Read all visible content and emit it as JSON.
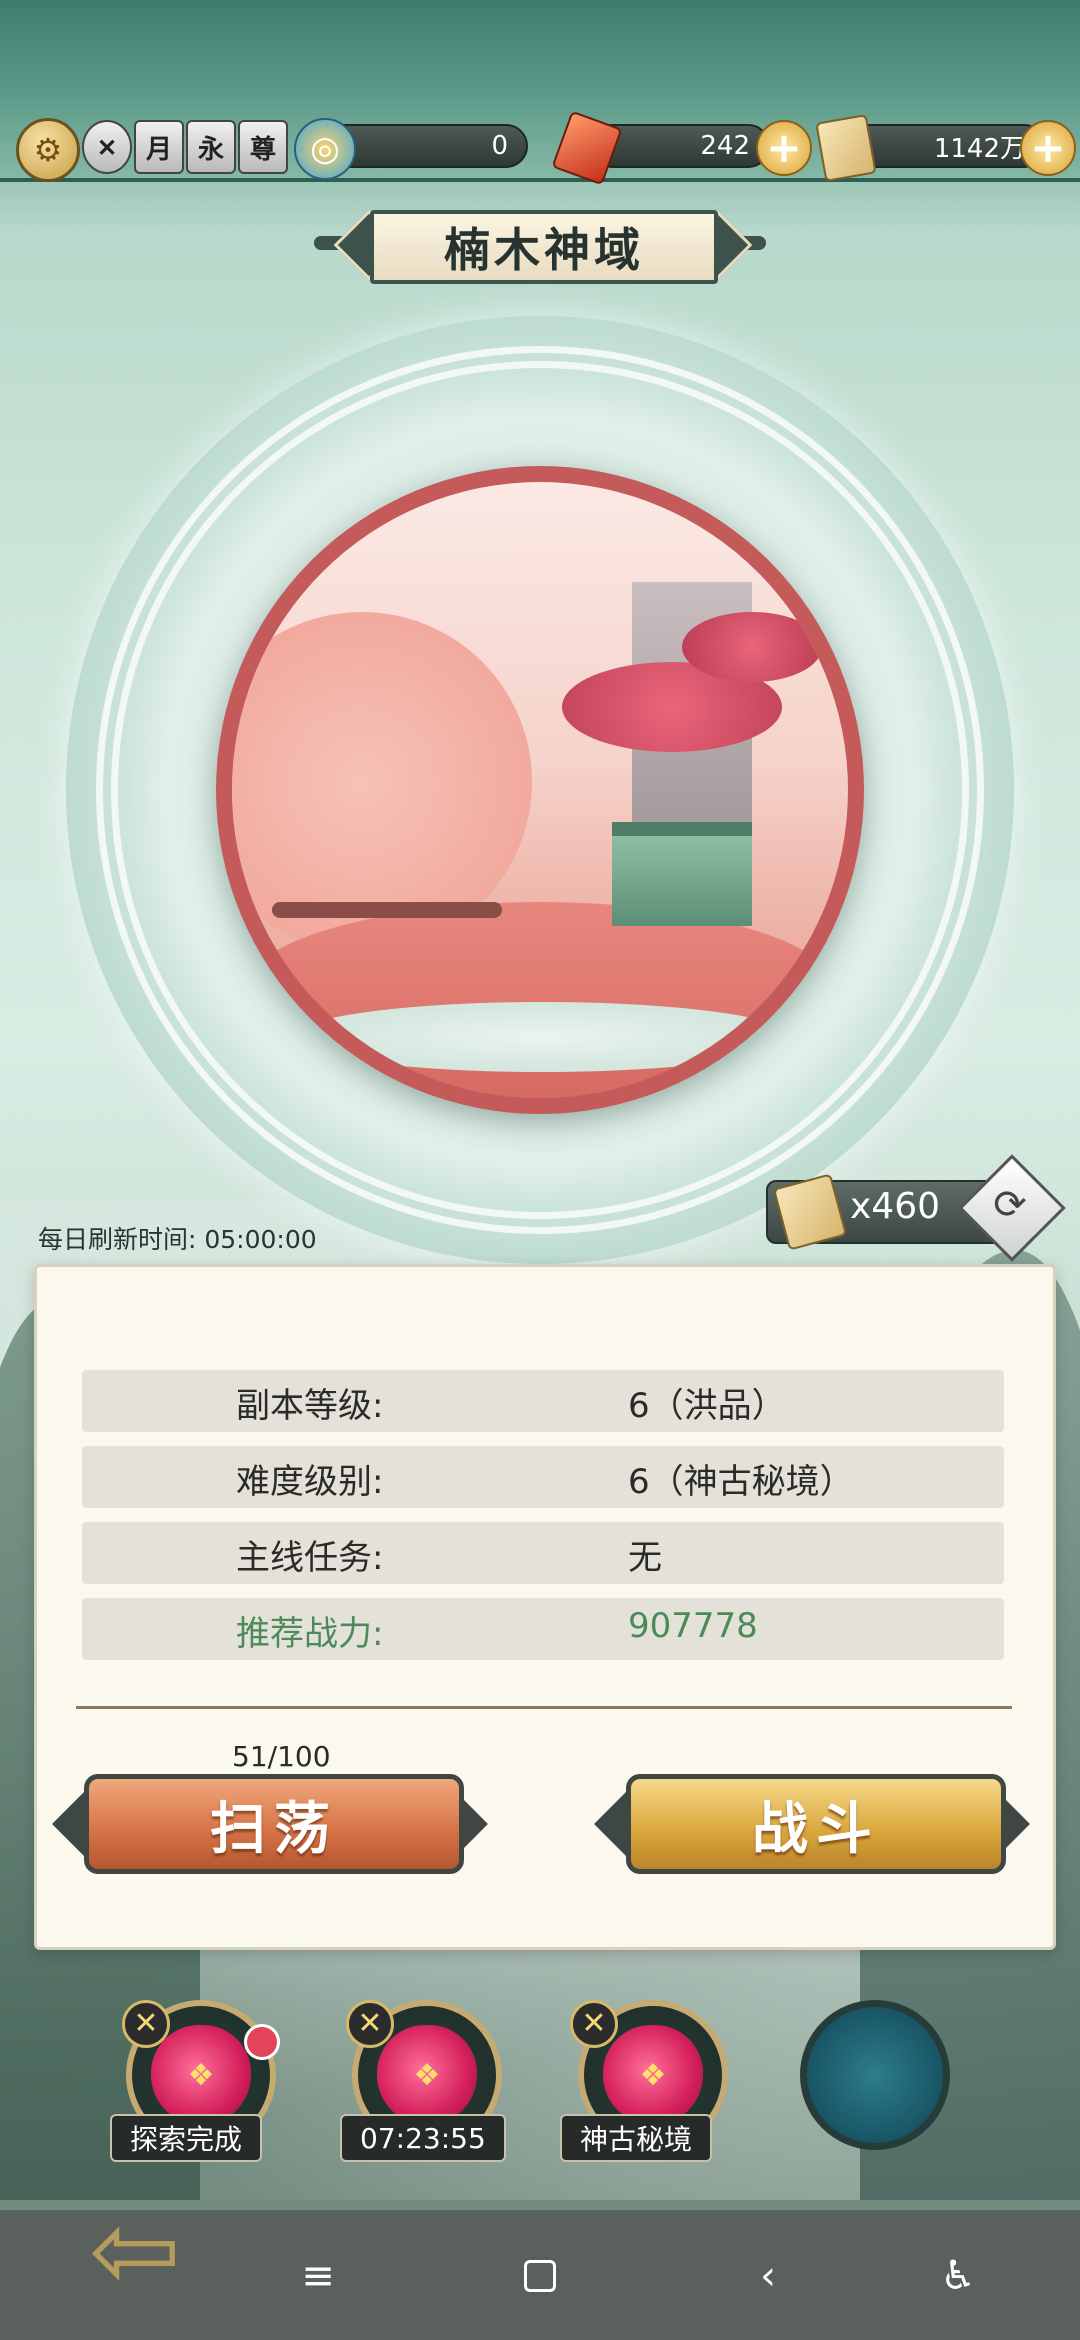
{
  "topbar": {
    "currency_jade": "0",
    "currency_gem": "242",
    "currency_scroll": "1142万",
    "badges": [
      "月",
      "永",
      "尊"
    ]
  },
  "title": "楠木神域",
  "refresh": {
    "label": "每日刷新时间: 05:00:00",
    "ticket_count": "x460"
  },
  "info": {
    "rows": [
      {
        "label": "副本等级:",
        "value": "6（洪品）"
      },
      {
        "label": "难度级别:",
        "value": "6（神古秘境）"
      },
      {
        "label": "主线任务:",
        "value": "无"
      },
      {
        "label": "推荐战力:",
        "value": "907778"
      }
    ]
  },
  "sweep_count": "51/100",
  "buttons": {
    "sweep": "扫荡",
    "fight": "战斗"
  },
  "slots": [
    {
      "label": "探索完成"
    },
    {
      "label": "07:23:55"
    },
    {
      "label": "神古秘境"
    }
  ],
  "colors": {
    "accent_green": "#4b8b5a",
    "sweep_orange": "#d47145",
    "fight_gold": "#d9a53a"
  }
}
